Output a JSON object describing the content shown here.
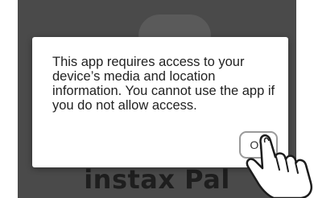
{
  "dialog": {
    "message": "This app requires access to your device’s media and location information. You cannot use the app if you do not allow access.",
    "ok_label": "OK"
  },
  "background": {
    "brand_text": "instax Pal"
  },
  "icons": {
    "pointer": "tapping-hand-icon"
  },
  "colors": {
    "screen_background": "#4a4a4a",
    "dialog_background": "#ffffff",
    "brand_text": "#1e1e1e"
  }
}
